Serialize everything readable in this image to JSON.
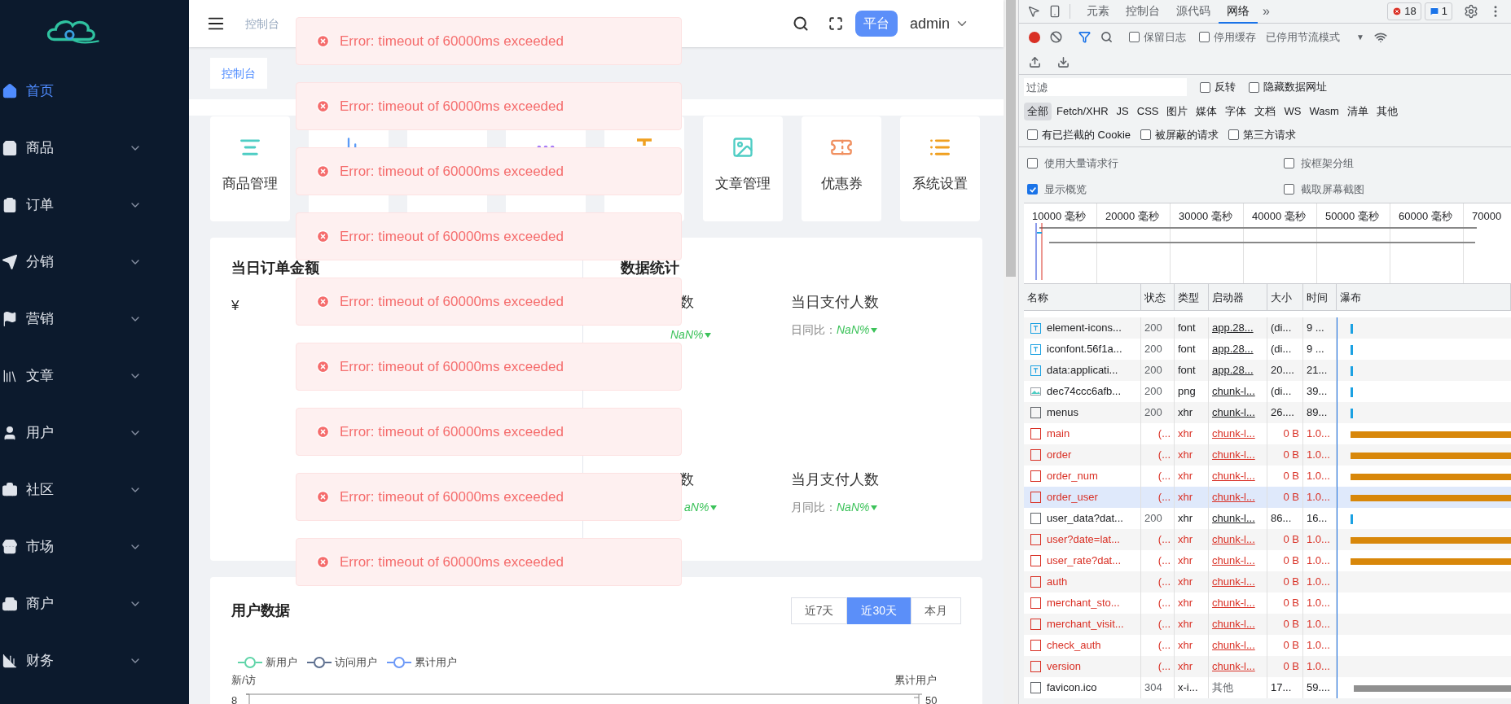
{
  "sidebar": {
    "items": [
      {
        "label": "首页",
        "kind": "home",
        "selected": true,
        "expandable": false
      },
      {
        "label": "商品",
        "kind": "goods",
        "selected": false,
        "expandable": true
      },
      {
        "label": "订单",
        "kind": "order",
        "selected": false,
        "expandable": true
      },
      {
        "label": "分销",
        "kind": "send",
        "selected": false,
        "expandable": true
      },
      {
        "label": "营销",
        "kind": "flag",
        "selected": false,
        "expandable": true
      },
      {
        "label": "文章",
        "kind": "article",
        "selected": false,
        "expandable": true
      },
      {
        "label": "用户",
        "kind": "user",
        "selected": false,
        "expandable": true
      },
      {
        "label": "社区",
        "kind": "community",
        "selected": false,
        "expandable": true
      },
      {
        "label": "市场",
        "kind": "market",
        "selected": false,
        "expandable": true
      },
      {
        "label": "商户",
        "kind": "merchant",
        "selected": false,
        "expandable": true
      },
      {
        "label": "财务",
        "kind": "finance",
        "selected": false,
        "expandable": true
      }
    ]
  },
  "header": {
    "breadcrumb": "控制台",
    "badge": "平台",
    "user": "admin"
  },
  "tags": [
    {
      "label": "控制台",
      "selected": true
    }
  ],
  "shortcuts": [
    {
      "kind": "lines",
      "label": "商品管理"
    },
    {
      "kind": "chart"
    },
    {
      "kind": "blank"
    },
    {
      "kind": "dots"
    },
    {
      "kind": "text"
    },
    {
      "kind": "image",
      "label": "文章管理"
    },
    {
      "kind": "coupon",
      "label": "优惠券"
    },
    {
      "kind": "list",
      "label": "系统设置"
    }
  ],
  "order_amount": {
    "title": "当日订单金额",
    "value": "¥"
  },
  "stats": {
    "title": "数据统计",
    "items": [
      {
        "label": "数",
        "value": "NaN%"
      },
      {
        "label": "当日支付人数",
        "compare_label": "日同比：",
        "value": "NaN%"
      },
      {
        "label": "数",
        "value": "aN%"
      },
      {
        "label": "当月支付人数",
        "compare_label": "月同比：",
        "value": "NaN%"
      }
    ]
  },
  "user_data": {
    "title": "用户数据",
    "ranges": [
      {
        "label": "近7天",
        "selected": false
      },
      {
        "label": "近30天",
        "selected": true
      },
      {
        "label": "本月",
        "selected": false
      }
    ],
    "legend": [
      {
        "label": "新用户",
        "color": "#5fd4a8"
      },
      {
        "label": "访问用户",
        "color": "#5d6f8f"
      },
      {
        "label": "累计用户",
        "color": "#6b98f7"
      }
    ],
    "left_axis": "新/访",
    "right_axis": "累计用户",
    "left_tick": "8",
    "right_tick": "50"
  },
  "toasts": [
    "Error: timeout of 60000ms exceeded",
    "Error: timeout of 60000ms exceeded",
    "Error: timeout of 60000ms exceeded",
    "Error: timeout of 60000ms exceeded",
    "Error: timeout of 60000ms exceeded",
    "Error: timeout of 60000ms exceeded",
    "Error: timeout of 60000ms exceeded",
    "Error: timeout of 60000ms exceeded",
    "Error: timeout of 60000ms exceeded"
  ],
  "devtools": {
    "tabs": [
      {
        "label": "元素",
        "selected": false
      },
      {
        "label": "控制台",
        "selected": false
      },
      {
        "label": "源代码",
        "selected": false
      },
      {
        "label": "网络",
        "selected": true
      }
    ],
    "more": "»",
    "errors": "18",
    "messages": "1",
    "toolbar": {
      "preserve_log": {
        "label": "保留日志",
        "checked": false
      },
      "disable_cache": {
        "label": "停用缓存",
        "checked": false
      },
      "throttling": "已停用节流模式",
      "throttle_caret": "▼"
    },
    "filter": {
      "placeholder": "过滤",
      "options": [
        {
          "label": "反转",
          "checked": false
        },
        {
          "label": "隐藏数据网址",
          "checked": false
        }
      ]
    },
    "types": [
      {
        "label": "全部",
        "selected": true
      },
      {
        "label": "Fetch/XHR",
        "selected": false
      },
      {
        "label": "JS",
        "selected": false
      },
      {
        "label": "CSS",
        "selected": false
      },
      {
        "label": "图片",
        "selected": false
      },
      {
        "label": "媒体",
        "selected": false
      },
      {
        "label": "字体",
        "selected": false
      },
      {
        "label": "文档",
        "selected": false
      },
      {
        "label": "WS",
        "selected": false
      },
      {
        "label": "Wasm",
        "selected": false
      },
      {
        "label": "清单",
        "selected": false
      },
      {
        "label": "其他",
        "selected": false
      }
    ],
    "request_filters": [
      {
        "label": "有已拦截的 Cookie",
        "checked": false
      },
      {
        "label": "被屏蔽的请求",
        "checked": false
      },
      {
        "label": "第三方请求",
        "checked": false
      }
    ],
    "settings": [
      {
        "label": "使用大量请求行",
        "checked": false
      },
      {
        "label": "按框架分组",
        "checked": false
      },
      {
        "label": "显示概览",
        "checked": true
      },
      {
        "label": "截取屏幕截图",
        "checked": false
      }
    ],
    "overview_ticks": [
      "10000 毫秒",
      "20000 毫秒",
      "30000 毫秒",
      "40000 毫秒",
      "50000 毫秒",
      "60000 毫秒",
      "70000"
    ],
    "columns": [
      "名称",
      "状态",
      "类型",
      "启动器",
      "大小",
      "时间",
      "瀑布"
    ],
    "rows": [
      {
        "kind": "font",
        "name": "element-icons...",
        "status": "200",
        "type": "font",
        "initiator": "app.28...",
        "size": "(di...",
        "time": "9 ...",
        "failed": false,
        "selected": false,
        "bar": {
          "kind": "tick"
        }
      },
      {
        "kind": "font",
        "name": "iconfont.56f1a...",
        "status": "200",
        "type": "font",
        "initiator": "app.28...",
        "size": "(di...",
        "time": "9 ...",
        "failed": false,
        "selected": false,
        "bar": {
          "kind": "tick"
        }
      },
      {
        "kind": "font",
        "name": "data:applicati...",
        "status": "200",
        "type": "font",
        "initiator": "app.28...",
        "size": "20....",
        "time": "21...",
        "failed": false,
        "selected": false,
        "bar": {
          "kind": "tick"
        }
      },
      {
        "kind": "image",
        "name": "dec74ccc6afb...",
        "status": "200",
        "type": "png",
        "initiator": "chunk-l...",
        "size": "(di...",
        "time": "39...",
        "failed": false,
        "selected": false,
        "bar": {
          "kind": "tick"
        }
      },
      {
        "kind": "doc",
        "name": "menus",
        "status": "200",
        "type": "xhr",
        "initiator": "chunk-l...",
        "size": "26....",
        "time": "89...",
        "failed": false,
        "selected": false,
        "bar": {
          "kind": "tick"
        }
      },
      {
        "kind": "doc",
        "name": "main",
        "status": "(...",
        "type": "xhr",
        "initiator": "chunk-l...",
        "size": "0 B",
        "time": "1.0...",
        "failed": true,
        "selected": false,
        "bar": {
          "kind": "pending"
        }
      },
      {
        "kind": "doc",
        "name": "order",
        "status": "(...",
        "type": "xhr",
        "initiator": "chunk-l...",
        "size": "0 B",
        "time": "1.0...",
        "failed": true,
        "selected": false,
        "bar": {
          "kind": "pending"
        }
      },
      {
        "kind": "doc",
        "name": "order_num",
        "status": "(...",
        "type": "xhr",
        "initiator": "chunk-l...",
        "size": "0 B",
        "time": "1.0...",
        "failed": true,
        "selected": false,
        "bar": {
          "kind": "pending"
        }
      },
      {
        "kind": "doc",
        "name": "order_user",
        "status": "(...",
        "type": "xhr",
        "initiator": "chunk-l...",
        "size": "0 B",
        "time": "1.0...",
        "failed": true,
        "selected": true,
        "bar": {
          "kind": "pending"
        }
      },
      {
        "kind": "doc",
        "name": "user_data?dat...",
        "status": "200",
        "type": "xhr",
        "initiator": "chunk-l...",
        "size": "86...",
        "time": "16...",
        "failed": false,
        "selected": false,
        "bar": {
          "kind": "tick"
        }
      },
      {
        "kind": "doc",
        "name": "user?date=lat...",
        "status": "(...",
        "type": "xhr",
        "initiator": "chunk-l...",
        "size": "0 B",
        "time": "1.0...",
        "failed": true,
        "selected": false,
        "bar": {
          "kind": "pending"
        }
      },
      {
        "kind": "doc",
        "name": "user_rate?dat...",
        "status": "(...",
        "type": "xhr",
        "initiator": "chunk-l...",
        "size": "0 B",
        "time": "1.0...",
        "failed": true,
        "selected": false,
        "bar": {
          "kind": "pending"
        }
      },
      {
        "kind": "doc",
        "name": "auth",
        "status": "(...",
        "type": "xhr",
        "initiator": "chunk-l...",
        "size": "0 B",
        "time": "1.0...",
        "failed": true,
        "selected": false
      },
      {
        "kind": "doc",
        "name": "merchant_sto...",
        "status": "(...",
        "type": "xhr",
        "initiator": "chunk-l...",
        "size": "0 B",
        "time": "1.0...",
        "failed": true,
        "selected": false
      },
      {
        "kind": "doc",
        "name": "merchant_visit...",
        "status": "(...",
        "type": "xhr",
        "initiator": "chunk-l...",
        "size": "0 B",
        "time": "1.0...",
        "failed": true,
        "selected": false
      },
      {
        "kind": "doc",
        "name": "check_auth",
        "status": "(...",
        "type": "xhr",
        "initiator": "chunk-l...",
        "size": "0 B",
        "time": "1.0...",
        "failed": true,
        "selected": false
      },
      {
        "kind": "doc",
        "name": "version",
        "status": "(...",
        "type": "xhr",
        "initiator": "chunk-l...",
        "size": "0 B",
        "time": "1.0...",
        "failed": true,
        "selected": false
      },
      {
        "kind": "doc",
        "name": "favicon.ico",
        "status": "304",
        "type": "x-i...",
        "initiator": "其他",
        "initiator_plain": true,
        "size": "17...",
        "time": "59....",
        "failed": false,
        "selected": false,
        "bar": {
          "kind": "late"
        }
      }
    ]
  }
}
